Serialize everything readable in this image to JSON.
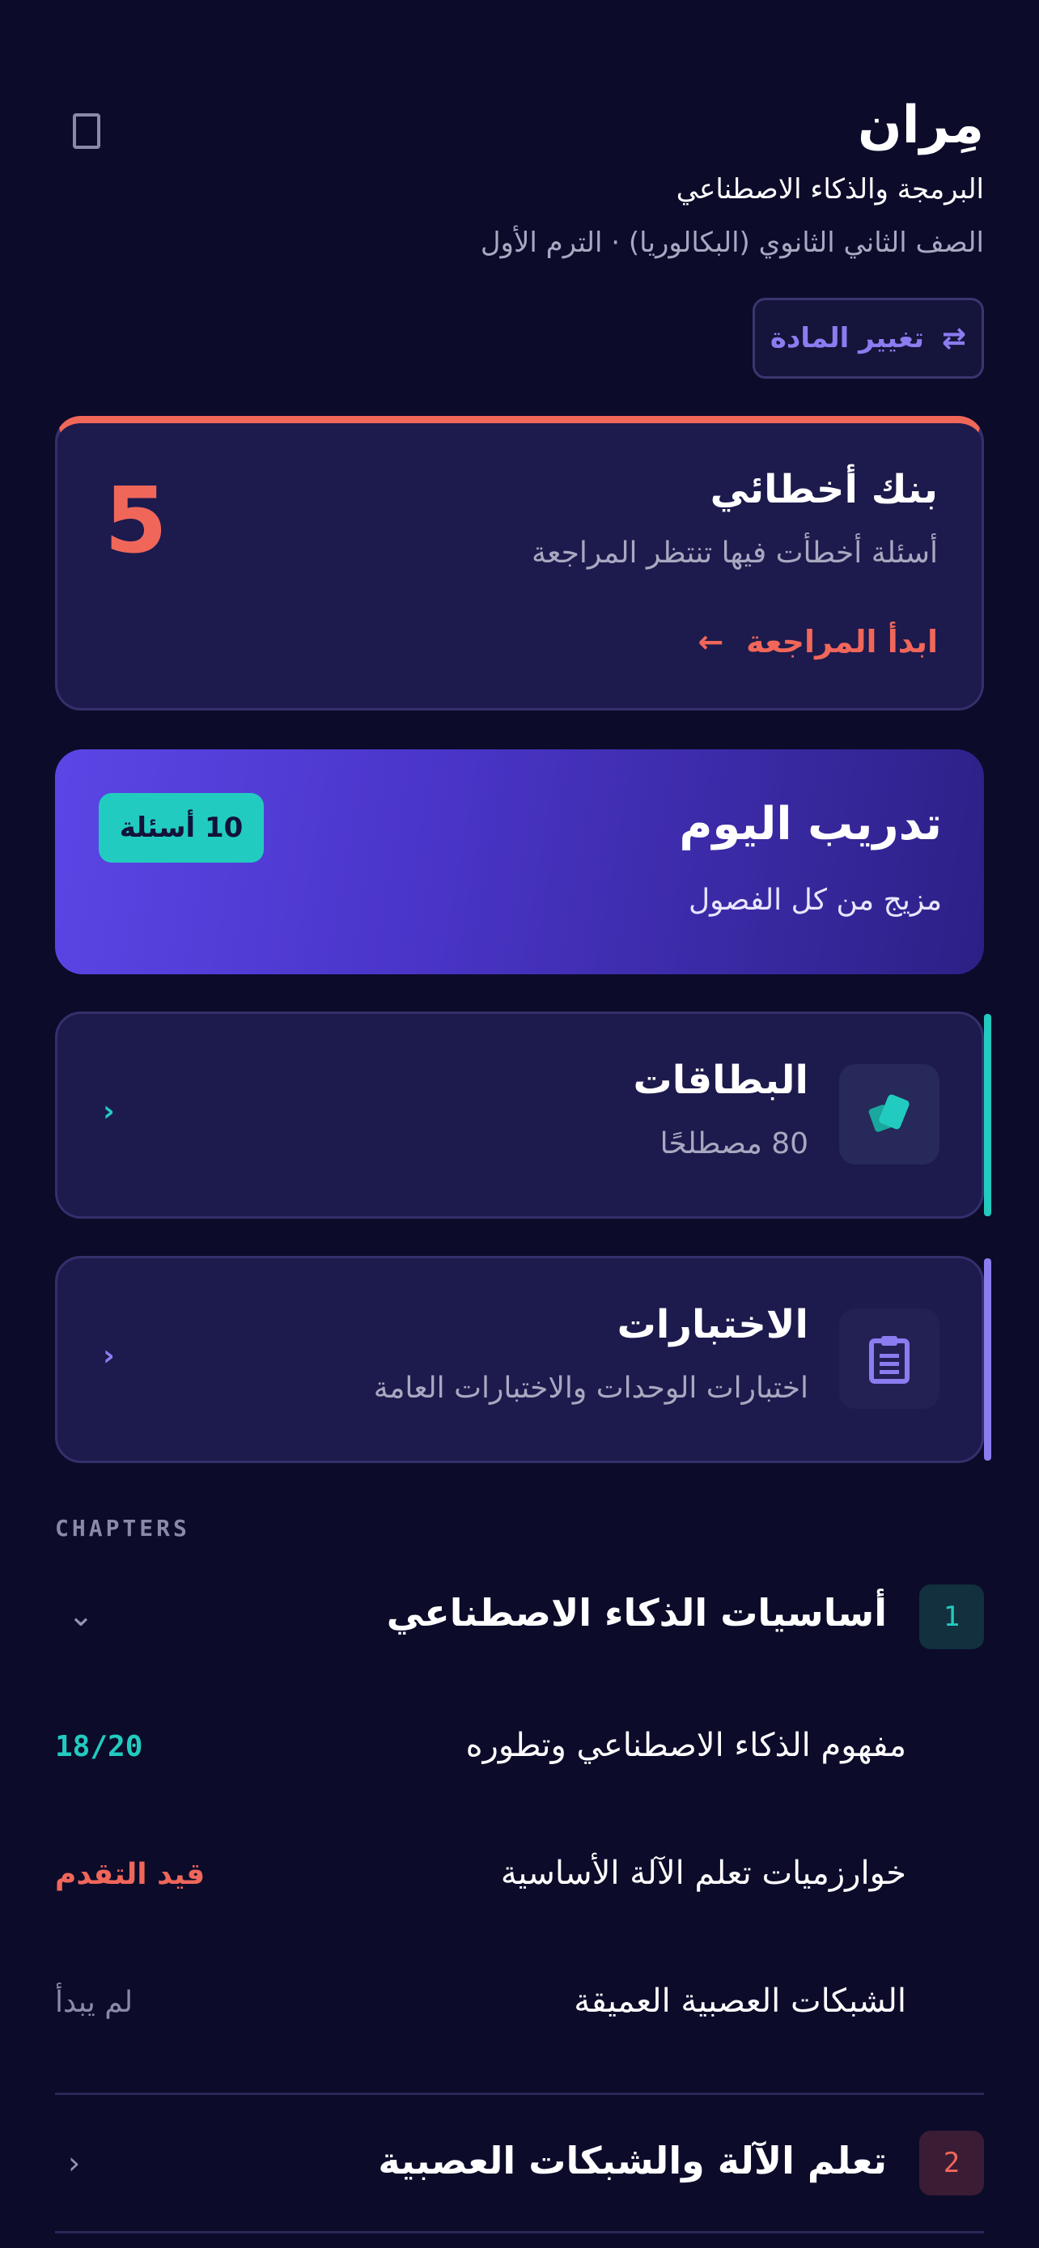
{
  "header": {
    "app_title": "مِران",
    "subject": "البرمجة والذكاء الاصطناعي",
    "grade": "الصف الثاني الثانوي (البكالوريا) · الترم الأول",
    "change_subject_label": "تغيير المادة",
    "swap_icon": "⇄"
  },
  "mistakes_bank": {
    "title": "بنك أخطائي",
    "description": "أسئلة أخطأت فيها تنتظر المراجعة",
    "cta_label": "ابدأ المراجعة",
    "cta_arrow": "←",
    "count": "5",
    "accent": "#f0675a"
  },
  "daily_training": {
    "title": "تدريب اليوم",
    "description": "مزيج من كل الفصول",
    "badge": "10 أسئلة"
  },
  "features": {
    "cards": {
      "title": "البطاقات",
      "description": "80 مصطلحًا",
      "chevron": "›",
      "icon": "cards-icon",
      "accent": "#22cbbf"
    },
    "tests": {
      "title": "الاختبارات",
      "description": "اختبارات الوحدات والاختبارات العامة",
      "chevron": "›",
      "icon": "clipboard-icon",
      "accent": "#8b7cf0"
    }
  },
  "chapters": {
    "label": "CHAPTERS",
    "items": [
      {
        "number": "1",
        "title": "أساسيات الذكاء الاصطناعي",
        "chevron": "⌄",
        "lessons": [
          {
            "title": "مفهوم الذكاء الاصطناعي وتطوره",
            "status": "18/20"
          },
          {
            "title": "خوارزميات تعلم الآلة الأساسية",
            "status": "قيد التقدم"
          },
          {
            "title": "الشبكات العصبية العميقة",
            "status": "لم يبدأ"
          }
        ]
      },
      {
        "number": "2",
        "title": "تعلم الآلة والشبكات العصبية",
        "chevron": "›"
      }
    ]
  },
  "colors": {
    "background": "#0c0b2a",
    "card": "#1d1a4d",
    "teal": "#22cbbf",
    "purple": "#8b7cf0",
    "coral": "#f0675a"
  }
}
